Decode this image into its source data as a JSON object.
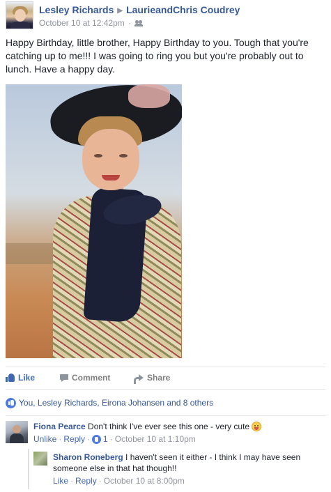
{
  "post": {
    "author": "Lesley Richards",
    "target": "LaurieandChris Coudrey",
    "timestamp": "October 10 at 12:42pm",
    "meta_separator": "·",
    "audience_icon": "friends-icon",
    "text": "Happy Birthday, little brother, Happy Birthday to you. Tough that you're catching up to me!!! I was going to ring you but you're probably out to lunch. Have a happy day."
  },
  "actions": {
    "like_label": "Like",
    "comment_label": "Comment",
    "share_label": "Share"
  },
  "likes_summary": {
    "text": "You, Lesley Richards, Eirona Johansen and 8 others"
  },
  "comments": [
    {
      "author": "Fiona Pearce",
      "text": "Don't think I've ever see this one - very cute",
      "emoji": "tongue-out-emoji",
      "unlike_label": "Unlike",
      "reply_label": "Reply",
      "separator": "·",
      "like_count": "1",
      "timestamp": "October 10 at 1:10pm"
    },
    {
      "author": "Sharon Roneberg",
      "text": "I haven't seen it either - I think I may have seen someone else in that hat though!!",
      "like_label": "Like",
      "reply_label": "Reply",
      "separator": "·",
      "timestamp": "October 10 at 8:00pm"
    }
  ],
  "colors": {
    "link_blue": "#365899",
    "action_blue": "#4267b2",
    "meta_gray": "#90949c"
  }
}
